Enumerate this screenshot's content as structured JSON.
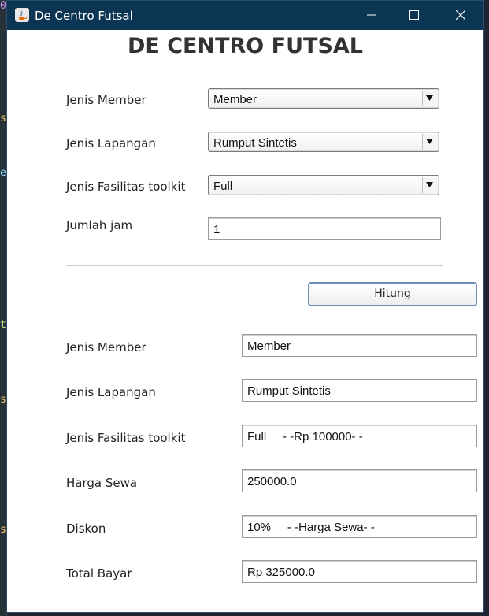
{
  "window": {
    "title": "De Centro Futsal"
  },
  "heading": "DE CENTRO FUTSAL",
  "form": {
    "member_label": "Jenis Member",
    "member_value": "Member",
    "lapangan_label": "Jenis Lapangan",
    "lapangan_value": "Rumput Sintetis",
    "fasilitas_label": "Jenis Fasilitas toolkit",
    "fasilitas_value": "Full",
    "jam_label": "Jumlah jam",
    "jam_value": "1"
  },
  "hitung_label": "Hitung",
  "result": {
    "member_label": "Jenis Member",
    "member_value": "Member",
    "lapangan_label": "Jenis Lapangan",
    "lapangan_value": "Rumput Sintetis",
    "fasilitas_label": "Jenis Fasilitas toolkit",
    "fasilitas_value": "Full     - -Rp 100000- -",
    "harga_label": "Harga Sewa",
    "harga_value": "250000.0",
    "diskon_label": "Diskon",
    "diskon_value": "10%     - -Harga Sewa- -",
    "total_label": "Total Bayar",
    "total_value": "Rp 325000.0"
  },
  "colors": {
    "titlebar": "#0b3553",
    "button_border": "#6b8fb8"
  },
  "icons": [
    "java-icon",
    "minimize-icon",
    "maximize-icon",
    "close-icon",
    "dropdown-arrow-icon"
  ]
}
